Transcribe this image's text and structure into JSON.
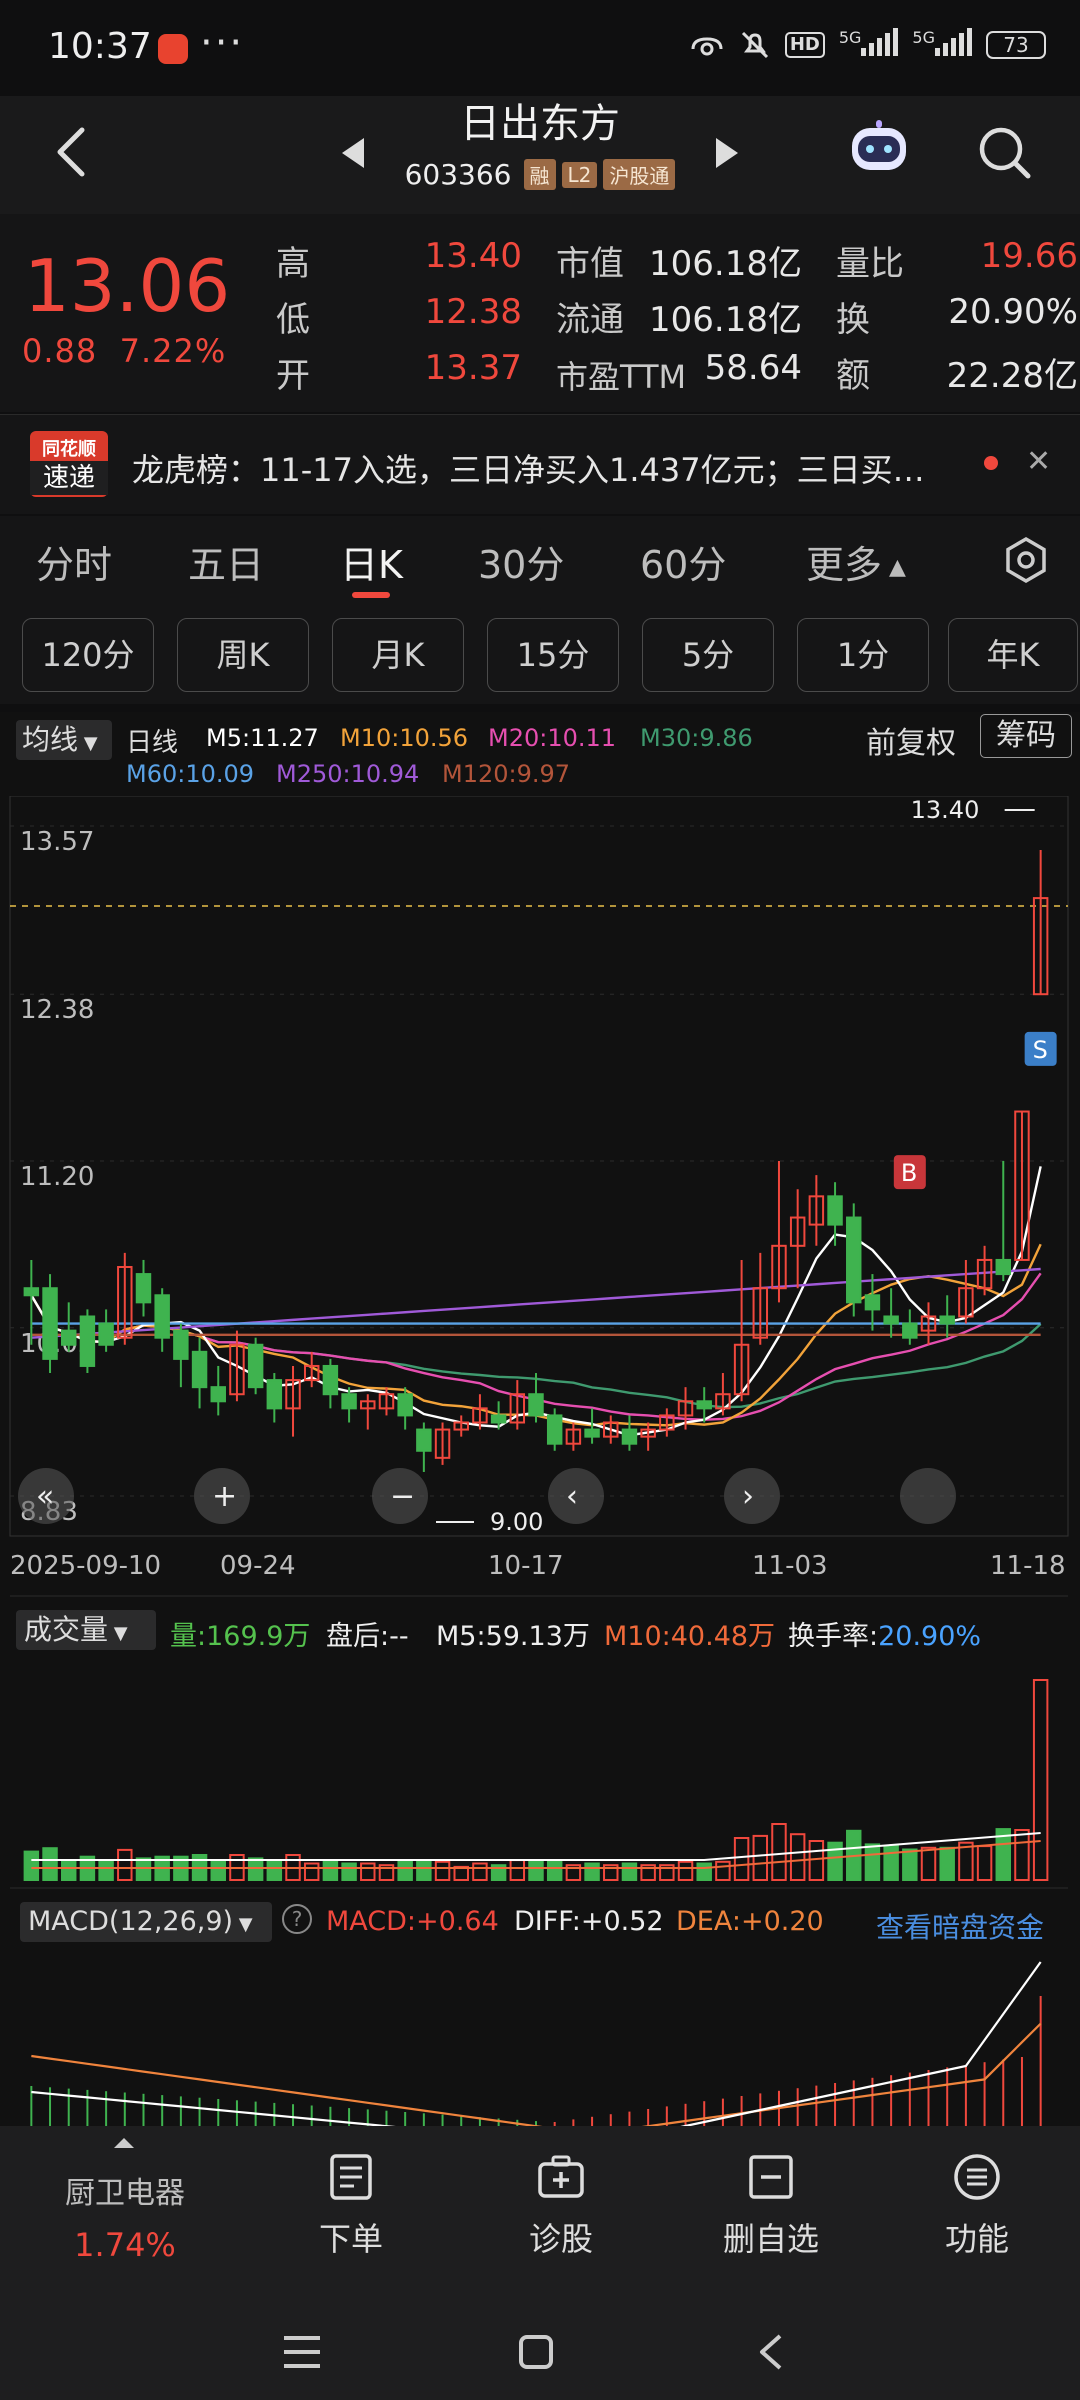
{
  "status_bar": {
    "time": "10:37",
    "dots": "···",
    "hd": "HD",
    "net1": "5G",
    "net2": "5G",
    "battery": "73"
  },
  "header": {
    "title": "日出东方",
    "code": "603366",
    "tags": [
      "融",
      "L2",
      "沪股通"
    ]
  },
  "quote": {
    "price": "13.06",
    "change": "0.88",
    "change_pct": "7.22%",
    "stats": [
      {
        "label": "高",
        "value": "13.40",
        "color": "red"
      },
      {
        "label": "低",
        "value": "12.38",
        "color": "red"
      },
      {
        "label": "开",
        "value": "13.37",
        "color": "red"
      },
      {
        "label": "市值",
        "value": "106.18亿",
        "color": "white"
      },
      {
        "label": "流通",
        "value": "106.18亿",
        "color": "white"
      },
      {
        "label": "市盈TTM",
        "value": "58.64",
        "color": "white"
      },
      {
        "label": "量比",
        "value": "19.66",
        "color": "red"
      },
      {
        "label": "换",
        "value": "20.90%",
        "color": "white"
      },
      {
        "label": "额",
        "value": "22.28亿",
        "color": "white"
      }
    ]
  },
  "longhu": {
    "logo_top": "同花顺",
    "logo_bottom": "速递",
    "text": "龙虎榜：11-17入选，三日净买入1.437亿元；三日买…"
  },
  "tabs": {
    "items": [
      "分时",
      "五日",
      "日K",
      "30分",
      "60分",
      "更多"
    ],
    "active": "日K"
  },
  "sub_tabs": [
    "120分",
    "周K",
    "月K",
    "15分",
    "5分",
    "1分",
    "年K"
  ],
  "legend": {
    "selector": "均线",
    "period": "日线",
    "m5": "M5:11.27",
    "m10": "M10:10.56",
    "m20": "M20:10.11",
    "m30": "M30:9.86",
    "m60": "M60:10.09",
    "m250": "M250:10.94",
    "m120": "M120:9.97",
    "fq": "前复权",
    "chip": "筹码",
    "colors": {
      "m5": "#ffffff",
      "m10": "#f2a33a",
      "m20": "#e64fb0",
      "m30": "#3f9a6f",
      "m60": "#5aa2e6",
      "m250": "#a05ad8",
      "m120": "#b3553a"
    }
  },
  "chart_data": {
    "type": "candlestick",
    "price_ticks": [
      "13.57",
      "12.38",
      "11.20",
      "10.02",
      "8.83"
    ],
    "ylim": [
      8.83,
      13.57
    ],
    "high_label": "13.40",
    "low_label": "9.00",
    "x_ticks": [
      "2025-09-10",
      "09-24",
      "10-17",
      "11-03",
      "11-18"
    ],
    "candles": [
      [
        10.3,
        10.5,
        10.25,
        9.9
      ],
      [
        10.3,
        10.4,
        9.8,
        9.7
      ],
      [
        10.0,
        10.2,
        9.9,
        9.85
      ],
      [
        10.1,
        10.15,
        9.75,
        9.7
      ],
      [
        10.05,
        10.15,
        9.9,
        9.85
      ],
      [
        9.95,
        10.55,
        10.45,
        9.9
      ],
      [
        10.4,
        10.5,
        10.2,
        10.1
      ],
      [
        10.25,
        10.3,
        9.95,
        9.85
      ],
      [
        10.0,
        10.05,
        9.8,
        9.6
      ],
      [
        9.85,
        9.95,
        9.6,
        9.45
      ],
      [
        9.6,
        9.75,
        9.5,
        9.4
      ],
      [
        9.55,
        10.0,
        9.9,
        9.5
      ],
      [
        9.9,
        9.95,
        9.6,
        9.55
      ],
      [
        9.65,
        9.7,
        9.45,
        9.35
      ],
      [
        9.45,
        9.75,
        9.65,
        9.25
      ],
      [
        9.65,
        9.85,
        9.75,
        9.6
      ],
      [
        9.75,
        9.8,
        9.55,
        9.45
      ],
      [
        9.55,
        9.6,
        9.45,
        9.35
      ],
      [
        9.45,
        9.55,
        9.5,
        9.3
      ],
      [
        9.45,
        9.6,
        9.55,
        9.4
      ],
      [
        9.55,
        9.6,
        9.4,
        9.3
      ],
      [
        9.3,
        9.35,
        9.15,
        9.0
      ],
      [
        9.1,
        9.35,
        9.3,
        9.05
      ],
      [
        9.3,
        9.4,
        9.35,
        9.25
      ],
      [
        9.35,
        9.55,
        9.45,
        9.3
      ],
      [
        9.4,
        9.5,
        9.35,
        9.3
      ],
      [
        9.35,
        9.65,
        9.55,
        9.3
      ],
      [
        9.55,
        9.7,
        9.4,
        9.35
      ],
      [
        9.4,
        9.45,
        9.2,
        9.15
      ],
      [
        9.2,
        9.35,
        9.3,
        9.15
      ],
      [
        9.3,
        9.45,
        9.25,
        9.2
      ],
      [
        9.25,
        9.4,
        9.35,
        9.2
      ],
      [
        9.3,
        9.4,
        9.2,
        9.15
      ],
      [
        9.25,
        9.35,
        9.3,
        9.15
      ],
      [
        9.3,
        9.45,
        9.4,
        9.25
      ],
      [
        9.4,
        9.6,
        9.5,
        9.3
      ],
      [
        9.5,
        9.6,
        9.45,
        9.35
      ],
      [
        9.45,
        9.7,
        9.55,
        9.4
      ],
      [
        9.55,
        10.5,
        9.9,
        9.5
      ],
      [
        9.95,
        10.55,
        10.3,
        9.9
      ],
      [
        10.3,
        11.2,
        10.6,
        10.2
      ],
      [
        10.6,
        11.0,
        10.8,
        10.3
      ],
      [
        10.75,
        11.1,
        10.95,
        10.6
      ],
      [
        10.95,
        11.05,
        10.75,
        10.6
      ],
      [
        10.8,
        10.9,
        10.2,
        10.1
      ],
      [
        10.25,
        10.4,
        10.15,
        10.0
      ],
      [
        10.1,
        10.3,
        10.05,
        9.95
      ],
      [
        10.05,
        10.15,
        9.95,
        9.9
      ],
      [
        10.0,
        10.2,
        10.1,
        9.9
      ],
      [
        10.1,
        10.25,
        10.05,
        9.95
      ],
      [
        10.1,
        10.5,
        10.3,
        10.05
      ],
      [
        10.3,
        10.6,
        10.5,
        10.25
      ],
      [
        10.5,
        11.2,
        10.4,
        10.35
      ],
      [
        10.5,
        11.55,
        11.55,
        10.5
      ],
      [
        12.38,
        13.4,
        13.06,
        12.38
      ]
    ],
    "volume_label": "量:169.9万",
    "after_hours": "盘后:--",
    "vol_m5": "M5:59.13万",
    "vol_m10": "M10:40.48万",
    "turnover_label": "换手率:",
    "turnover": "20.90%",
    "macd_title": "MACD(12,26,9)",
    "macd": "MACD:+0.64",
    "diff": "DIFF:+0.52",
    "dea": "DEA:+0.20",
    "macd_link": "查看暗盘资金"
  },
  "bottom_nav": {
    "sector": "厨卫电器",
    "sector_pct": "1.74%",
    "items": [
      "下单",
      "诊股",
      "删自选",
      "功能"
    ]
  }
}
